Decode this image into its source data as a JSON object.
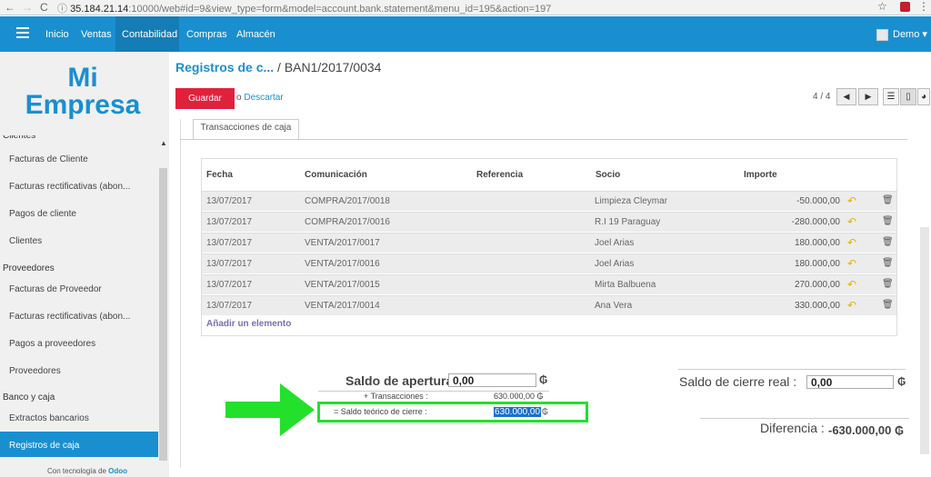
{
  "browser": {
    "back": "←",
    "forward": "→",
    "reload": "C",
    "info": "ⓘ",
    "url_host": "35.184.21.14",
    "url_rest": ":10000/web#id=9&view_type=form&model=account.bank.statement&menu_id=195&action=197",
    "star": "☆",
    "menu": "⋮"
  },
  "topnav": {
    "items": [
      "Inicio",
      "Ventas",
      "Contabilidad",
      "Compras",
      "Almacén"
    ],
    "active": "Contabilidad",
    "user": "Demo ▾"
  },
  "sidebar": {
    "logo_line1": "Mi",
    "logo_line2": "Empresa",
    "top_head": "Clientes",
    "items": [
      {
        "label": "Facturas de Cliente"
      },
      {
        "label": "Facturas rectificativas (abon..."
      },
      {
        "label": "Pagos de cliente"
      },
      {
        "label": "Clientes"
      }
    ],
    "head_suppliers": "Proveedores",
    "supplier_items": [
      {
        "label": "Facturas de Proveedor"
      },
      {
        "label": "Facturas rectificativas (abon..."
      },
      {
        "label": "Pagos a proveedores"
      },
      {
        "label": "Proveedores"
      }
    ],
    "head_bank": "Banco y caja",
    "bank_items": [
      {
        "label": "Extractos bancarios"
      },
      {
        "label": "Registros de caja"
      }
    ],
    "powered_prefix": "Con tecnología de",
    "powered_brand": "Odoo"
  },
  "header": {
    "crumb": "Registros de c...",
    "separator": "/",
    "record": "BAN1/2017/0034",
    "save": "Guardar",
    "discard_prefix": "o",
    "discard": "Descartar",
    "pager": "4 / 4"
  },
  "tab": {
    "label": "Transacciones de caja"
  },
  "table": {
    "headers": [
      "Fecha",
      "Comunicación",
      "Referencia",
      "Socio",
      "Importe"
    ],
    "rows": [
      {
        "date": "13/07/2017",
        "comm": "COMPRA/2017/0018",
        "ref": "",
        "partner": "Limpieza Cleymar",
        "amount": "-50.000,00"
      },
      {
        "date": "13/07/2017",
        "comm": "COMPRA/2017/0016",
        "ref": "",
        "partner": "R.I 19 Paraguay",
        "amount": "-280.000,00"
      },
      {
        "date": "13/07/2017",
        "comm": "VENTA/2017/0017",
        "ref": "",
        "partner": "Joel Arias",
        "amount": "180.000,00"
      },
      {
        "date": "13/07/2017",
        "comm": "VENTA/2017/0016",
        "ref": "",
        "partner": "Joel Arias",
        "amount": "180.000,00"
      },
      {
        "date": "13/07/2017",
        "comm": "VENTA/2017/0015",
        "ref": "",
        "partner": "Mirta Balbuena",
        "amount": "270.000,00"
      },
      {
        "date": "13/07/2017",
        "comm": "VENTA/2017/0014",
        "ref": "",
        "partner": "Ana Vera",
        "amount": "330.000,00"
      }
    ],
    "add_line": "Añadir un elemento"
  },
  "totals": {
    "opening_label": "Saldo de apertura :",
    "opening_value": "0,00",
    "currency": "₲",
    "transactions_label": "+ Transacciones :",
    "transactions_value": "630.000,00 ₲",
    "theoretical_label": "= Saldo teórico de cierre :",
    "theoretical_value": "630.000,00",
    "real_label": "Saldo de cierre real :",
    "real_value": "0,00",
    "difference_label": "Diferencia :",
    "difference_value": "-630.000,00 ₲"
  },
  "colors": {
    "brand": "#1a8fd0",
    "save": "#e0213c",
    "highlight": "#22e02b"
  }
}
